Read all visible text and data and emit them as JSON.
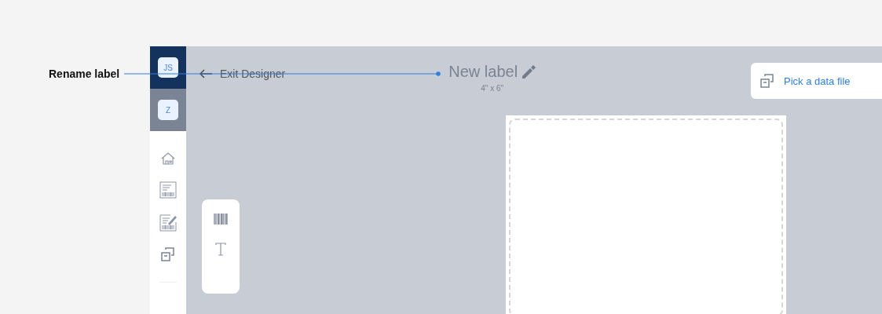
{
  "annotation": {
    "text": "Rename label"
  },
  "accounts": [
    {
      "initials": "JS",
      "selected": true
    },
    {
      "initials": "Z",
      "selected": false
    }
  ],
  "exit": {
    "label": "Exit Designer"
  },
  "label": {
    "title": "New label",
    "size": "4\" x 6\""
  },
  "data_file": {
    "label": "Pick a data file"
  }
}
